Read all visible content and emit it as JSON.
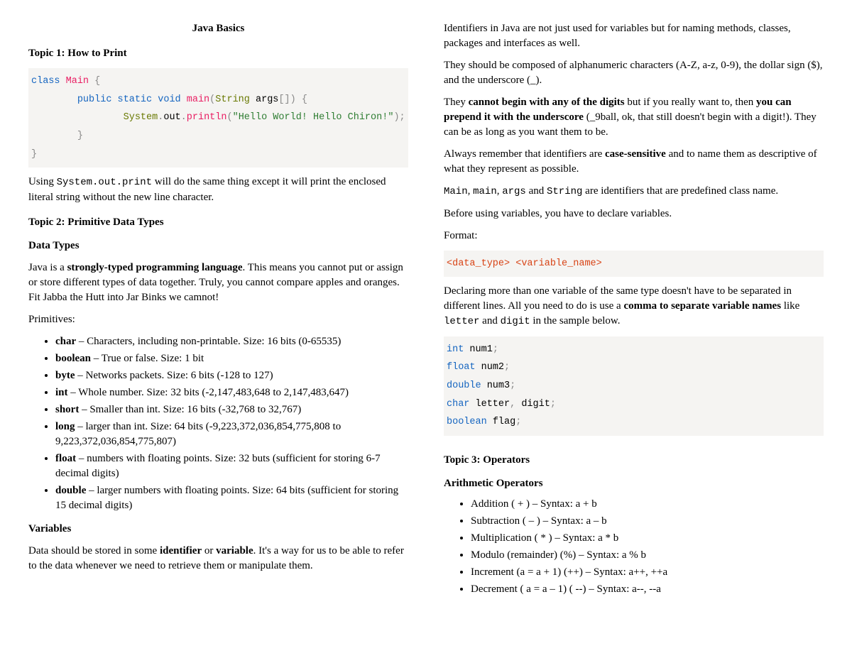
{
  "title": "Java Basics",
  "topic1": {
    "heading": "Topic 1: How to Print",
    "code": {
      "l1a": "class",
      "l1b": " Main",
      "l1c": " {",
      "l2a": "public",
      "l2b": " static",
      "l2c": " void",
      "l2d": " main",
      "l2e": "(",
      "l2f": "String",
      "l2g": " args",
      "l2h": "[])",
      "l2i": " {",
      "l3a": "System",
      "l3b": ".",
      "l3c": "out",
      "l3d": ".",
      "l3e": "println",
      "l3f": "(",
      "l3g": "\"Hello World! Hello Chiron!\"",
      "l3h": ")",
      "l3i": ";",
      "l4": "}",
      "l5": "}"
    },
    "para_a": "Using ",
    "para_code": "System.out.print",
    "para_b": " will do the same thing except it will print the enclosed literal string without the new line character."
  },
  "topic2": {
    "heading": "Topic 2: Primitive Data Types",
    "sub1": "Data Types",
    "p1a": "Java is a ",
    "p1b": "strongly-typed programming language",
    "p1c": ". This means you cannot put or assign or store different types of data together. Truly, you cannot compare apples and oranges. Fit Jabba the Hutt into Jar Binks we camnot!",
    "p2": "Primitives:",
    "items": [
      {
        "b": "char",
        "t": " – Characters, including non-printable. Size: 16 bits (0-65535)"
      },
      {
        "b": "boolean",
        "t": " – True or false. Size: 1 bit"
      },
      {
        "b": "byte",
        "t": " – Networks packets. Size: 6 bits (-128 to 127)"
      },
      {
        "b": "int",
        "t": " – Whole number. Size: 32 bits (-2,147,483,648 to 2,147,483,647)"
      },
      {
        "b": "short",
        "t": " – Smaller than int. Size: 16 bits (-32,768 to 32,767)"
      },
      {
        "b": "long",
        "t": " – larger than int. Size: 64 bits (-9,223,372,036,854,775,808 to 9,223,372,036,854,775,807)"
      },
      {
        "b": "float",
        "t": " – numbers with floating points. Size: 32 buts (sufficient for storing 6-7 decimal digits)"
      },
      {
        "b": "double",
        "t": " – larger numbers with floating points. Size: 64 bits (sufficient for storing 15 decimal digits)"
      }
    ],
    "sub2": "Variables",
    "p3a": "Data should be stored in some ",
    "p3b": "identifier",
    "p3c": " or ",
    "p3d": "variable",
    "p3e": ". It's a way for us to be able to refer to the data whenever we need to retrieve them or manipulate them.",
    "p4": "Identifiers in Java are not just used for variables but for naming methods, classes, packages and interfaces as well.",
    "p5": "They should be composed of alphanumeric characters (A-Z, a-z, 0-9), the dollar sign ($), and the underscore (_).",
    "p6a": " They ",
    "p6b": "cannot begin with any of the digits",
    "p6c": " but if you really want to, then ",
    "p6d": "you can prepend it with the underscore",
    "p6e": " (_9ball, ok, that still doesn't begin with a digit!). They can be as long as you want them to be.",
    "p7a": "Always remember that identifiers are ",
    "p7b": "case-sensitive",
    "p7c": " and to name them as descriptive of what they represent as possible.",
    "p8a": "Main",
    "p8b": ", ",
    "p8c": "main",
    "p8d": ", ",
    "p8e": "args",
    "p8f": " and ",
    "p8g": "String",
    "p8h": " are identifiers that are predefined class name.",
    "p9": "Before using variables, you have to declare variables.",
    "p10": "Format:",
    "fmt_code": {
      "a": "<data_type>",
      "b": " ",
      "c": "<variable_name>"
    },
    "p11a": "Declaring more than one variable of the same type doesn't have to be separated in different lines. All you need to do is use a ",
    "p11b": "comma to separate variable names",
    "p11c": " like ",
    "p11d": "letter",
    "p11e": " and ",
    "p11f": "digit",
    "p11g": " in the sample below.",
    "decl": {
      "l1a": "int",
      "l1b": " num1",
      "l1c": ";",
      "l2a": "float",
      "l2b": " num2",
      "l2c": ";",
      "l3a": "double",
      "l3b": " num3",
      "l3c": ";",
      "l4a": "char",
      "l4b": " letter",
      "l4c": ",",
      "l4d": " digit",
      "l4e": ";",
      "l5a": "boolean",
      "l5b": " flag",
      "l5c": ";"
    }
  },
  "topic3": {
    "heading": "Topic 3: Operators",
    "sub1": "Arithmetic Operators",
    "items": [
      "Addition ( + ) – Syntax: a + b",
      "Subtraction ( – ) – Syntax: a – b",
      "Multiplication ( * ) – Syntax: a * b",
      "Modulo (remainder) (%) – Syntax: a % b",
      "Increment (a = a + 1) (++) – Syntax: a++, ++a",
      "Decrement ( a = a – 1) ( --) – Syntax: a--, --a"
    ]
  }
}
